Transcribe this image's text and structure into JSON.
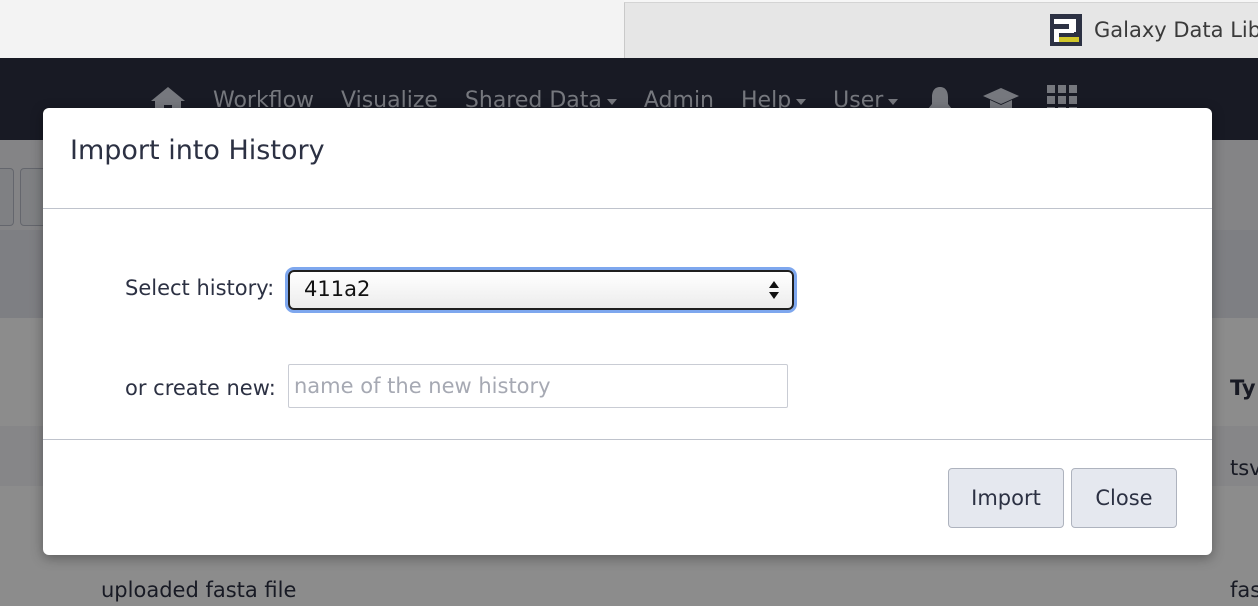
{
  "browser": {
    "tab_title": "Galaxy Data Lib"
  },
  "masthead": {
    "nav": [
      {
        "label": "Workflow",
        "dropdown": false
      },
      {
        "label": "Visualize",
        "dropdown": false
      },
      {
        "label": "Shared Data",
        "dropdown": true
      },
      {
        "label": "Admin",
        "dropdown": false
      },
      {
        "label": "Help",
        "dropdown": true
      },
      {
        "label": "User",
        "dropdown": true
      }
    ],
    "icons": [
      "home-icon",
      "bell-icon",
      "graduation-cap-icon",
      "grid-icon"
    ]
  },
  "background": {
    "column_header_partial": "Ty",
    "row1_type_partial": "tsv",
    "row2_name": "uploaded fasta file",
    "row2_type_partial": "fas"
  },
  "modal": {
    "title": "Import into History",
    "select_label": "Select history:",
    "selected_history": "411a2",
    "create_label": "or create new:",
    "new_history_placeholder": "name of the new history",
    "new_history_value": "",
    "import_label": "Import",
    "close_label": "Close"
  },
  "colors": {
    "masthead_bg": "#2c3143",
    "text": "#2c3143",
    "focus_ring": "#7ea7ee",
    "button_bg": "#e5e8ef",
    "logo_yellow": "#d0c62a"
  }
}
